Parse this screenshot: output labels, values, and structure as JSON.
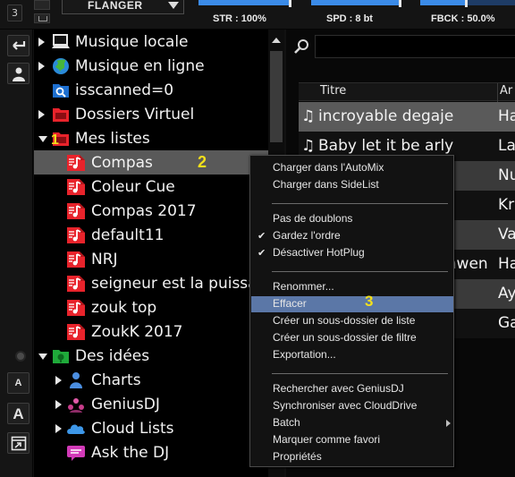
{
  "topbar": {
    "deck_number": "3",
    "effect_name": "FLANGER",
    "params": [
      {
        "label": "STR : 100%",
        "level": 1.0
      },
      {
        "label": "SPD : 8 bt",
        "level": 1.0
      },
      {
        "label": "FBCK : 50.0%",
        "level": 0.5
      }
    ]
  },
  "tools": {
    "font_small": "A",
    "font_large": "A"
  },
  "tree": {
    "items": [
      {
        "label": "Musique locale",
        "icon": "computer-icon",
        "arrow": "right"
      },
      {
        "label": "Musique en ligne",
        "icon": "globe-icon",
        "arrow": "right"
      },
      {
        "label": "isscanned=0",
        "icon": "search-folder-icon",
        "arrow": "none"
      },
      {
        "label": "Dossiers Virtuel",
        "icon": "red-folder-icon",
        "arrow": "right"
      },
      {
        "label": "Mes listes",
        "icon": "red-folder-icon",
        "arrow": "down"
      },
      {
        "label": "Compas",
        "icon": "playlist-icon",
        "arrow": "none",
        "selected": true
      },
      {
        "label": "Coleur Cue",
        "icon": "playlist-icon",
        "arrow": "none"
      },
      {
        "label": "Compas 2017",
        "icon": "playlist-icon",
        "arrow": "none"
      },
      {
        "label": "default11",
        "icon": "playlist-icon",
        "arrow": "none"
      },
      {
        "label": "NRJ",
        "icon": "playlist-icon",
        "arrow": "none"
      },
      {
        "label": "seigneur est la puissance",
        "icon": "playlist-icon",
        "arrow": "none"
      },
      {
        "label": "zouk top",
        "icon": "playlist-icon",
        "arrow": "none"
      },
      {
        "label": "ZoukK 2017",
        "icon": "playlist-icon",
        "arrow": "none"
      },
      {
        "label": "Des idées",
        "icon": "green-folder-icon",
        "arrow": "down"
      },
      {
        "label": "Charts",
        "icon": "person-icon",
        "arrow": "right"
      },
      {
        "label": "GeniusDJ",
        "icon": "genius-icon",
        "arrow": "right"
      },
      {
        "label": "Cloud Lists",
        "icon": "cloud-icon",
        "arrow": "right"
      },
      {
        "label": "Ask the DJ",
        "icon": "chat-icon",
        "arrow": "none"
      }
    ]
  },
  "list": {
    "search_placeholder": "",
    "columns": [
      "Titre",
      "Ar"
    ],
    "rows": [
      {
        "title": "incroyable degaje",
        "artist": "Ha",
        "selected": true
      },
      {
        "title": "Baby let it be  arly",
        "artist": "La"
      },
      {
        "title": "",
        "artist": "Nu"
      },
      {
        "title": "",
        "artist": "Kr"
      },
      {
        "title": "",
        "artist": "Va"
      },
      {
        "title": "mwen",
        "artist": "Ha"
      },
      {
        "title": "",
        "artist": "Ay"
      },
      {
        "title": "",
        "artist": "Ga"
      }
    ]
  },
  "context_menu": {
    "groups": [
      [
        {
          "label": "Charger dans l'AutoMix"
        },
        {
          "label": "Charger dans SideList"
        }
      ],
      [
        {
          "label": "Pas de doublons"
        },
        {
          "label": "Gardez l'ordre",
          "checked": true
        },
        {
          "label": "Désactiver HotPlug",
          "checked": true
        }
      ],
      [
        {
          "label": "Renommer..."
        },
        {
          "label": "Effacer",
          "highlighted": true
        },
        {
          "label": "Créer un sous-dossier de liste"
        },
        {
          "label": "Créer un sous-dossier de filtre"
        },
        {
          "label": "Exportation..."
        }
      ],
      [
        {
          "label": "Rechercher avec GeniusDJ"
        },
        {
          "label": "Synchroniser avec CloudDrive"
        },
        {
          "label": "Batch",
          "submenu": true
        },
        {
          "label": "Marquer comme favori"
        },
        {
          "label": "Propriétés"
        }
      ]
    ]
  },
  "annotations": [
    "1",
    "2",
    "3"
  ],
  "colors": {
    "selection_gray": "#595959",
    "menu_highlight": "#5b77a7",
    "slider_blue": "#3b8be8",
    "annotation_yellow": "#f3e01b",
    "playlist_red": "#e8232b"
  }
}
